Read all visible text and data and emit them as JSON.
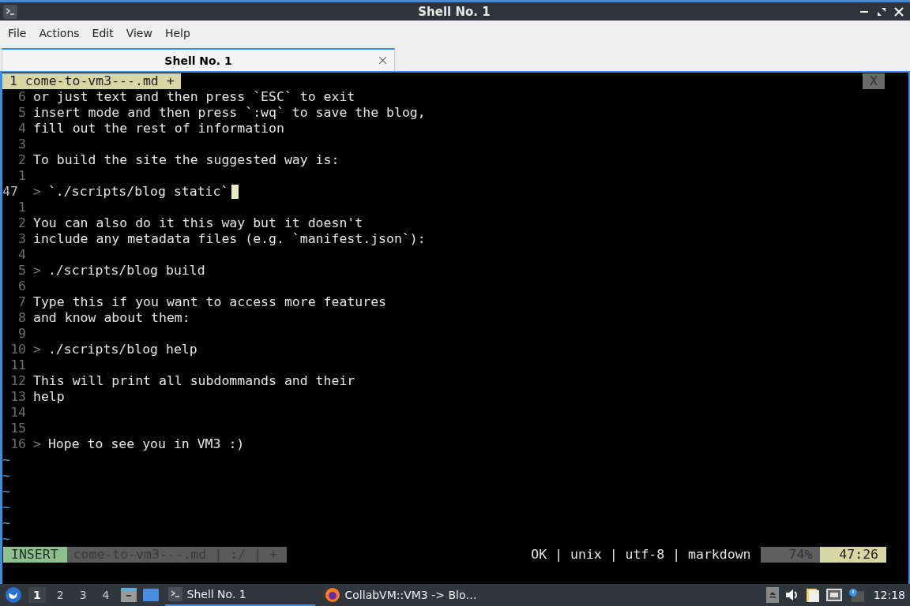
{
  "window": {
    "title": "Shell No. 1"
  },
  "menu": [
    "File",
    "Actions",
    "Edit",
    "View",
    "Help"
  ],
  "tabs": [
    {
      "label": "Shell No. 1",
      "selected": true
    }
  ],
  "vim": {
    "tabline": {
      "label": "1 come-to-vm3---.md +",
      "close": "X"
    },
    "lines": [
      {
        "number": "6",
        "text": "or just text and then press `ESC` to exit",
        "current": false
      },
      {
        "number": "5",
        "text": "insert mode and then press `:wq` to save the blog,",
        "current": false
      },
      {
        "number": "4",
        "text": "fill out the rest of information",
        "current": false
      },
      {
        "number": "3",
        "current": false
      },
      {
        "number": "2",
        "text": "To build the site the suggested way is:",
        "current": false
      },
      {
        "number": "1",
        "current": false
      },
      {
        "number": "47",
        "marker": ">",
        "text": "`./scripts/blog static`",
        "current": true
      },
      {
        "number": "1",
        "current": false
      },
      {
        "number": "2",
        "text": "You can also do it this way but it doesn't",
        "current": false
      },
      {
        "number": "3",
        "text": "include any metadata files (e.g. `manifest.json`):",
        "current": false
      },
      {
        "number": "4",
        "current": false
      },
      {
        "number": "5",
        "marker": ">",
        "text": "./scripts/blog build",
        "current": false
      },
      {
        "number": "6",
        "current": false
      },
      {
        "number": "7",
        "text": "Type this if you want to access more features",
        "current": false
      },
      {
        "number": "8",
        "text": "and know about them:",
        "current": false
      },
      {
        "number": "9",
        "current": false
      },
      {
        "number": "10",
        "marker": ">",
        "text": "./scripts/blog help",
        "current": false
      },
      {
        "number": "11",
        "current": false
      },
      {
        "number": "12",
        "text": "This will print all subdommands and their",
        "current": false
      },
      {
        "number": "13",
        "text": "help",
        "current": false
      },
      {
        "number": "14",
        "current": false
      },
      {
        "number": "15",
        "current": false
      },
      {
        "number": "16",
        "marker": ">",
        "text": "Hope to see you in VM3 :)",
        "current": false
      }
    ],
    "filler": [
      "~",
      "~",
      "~",
      "~",
      "~",
      "~"
    ],
    "status": {
      "mode": "INSERT",
      "file": "come-to-vm3---.md | :/ | +",
      "info": "OK | unix | utf-8 | markdown",
      "percent": "74%",
      "position": "47:26"
    }
  },
  "taskbar": {
    "workspaces": [
      {
        "label": "1",
        "selected": true
      },
      {
        "label": "2",
        "selected": false
      },
      {
        "label": "3",
        "selected": false
      },
      {
        "label": "4",
        "selected": false
      }
    ],
    "tasks": [
      {
        "label": "Shell No. 1",
        "selected": true,
        "kind": "terminal"
      },
      {
        "label": "CollabVM::VM3 -> Blo…",
        "selected": false,
        "kind": "browser"
      }
    ],
    "clock": "12:18"
  }
}
